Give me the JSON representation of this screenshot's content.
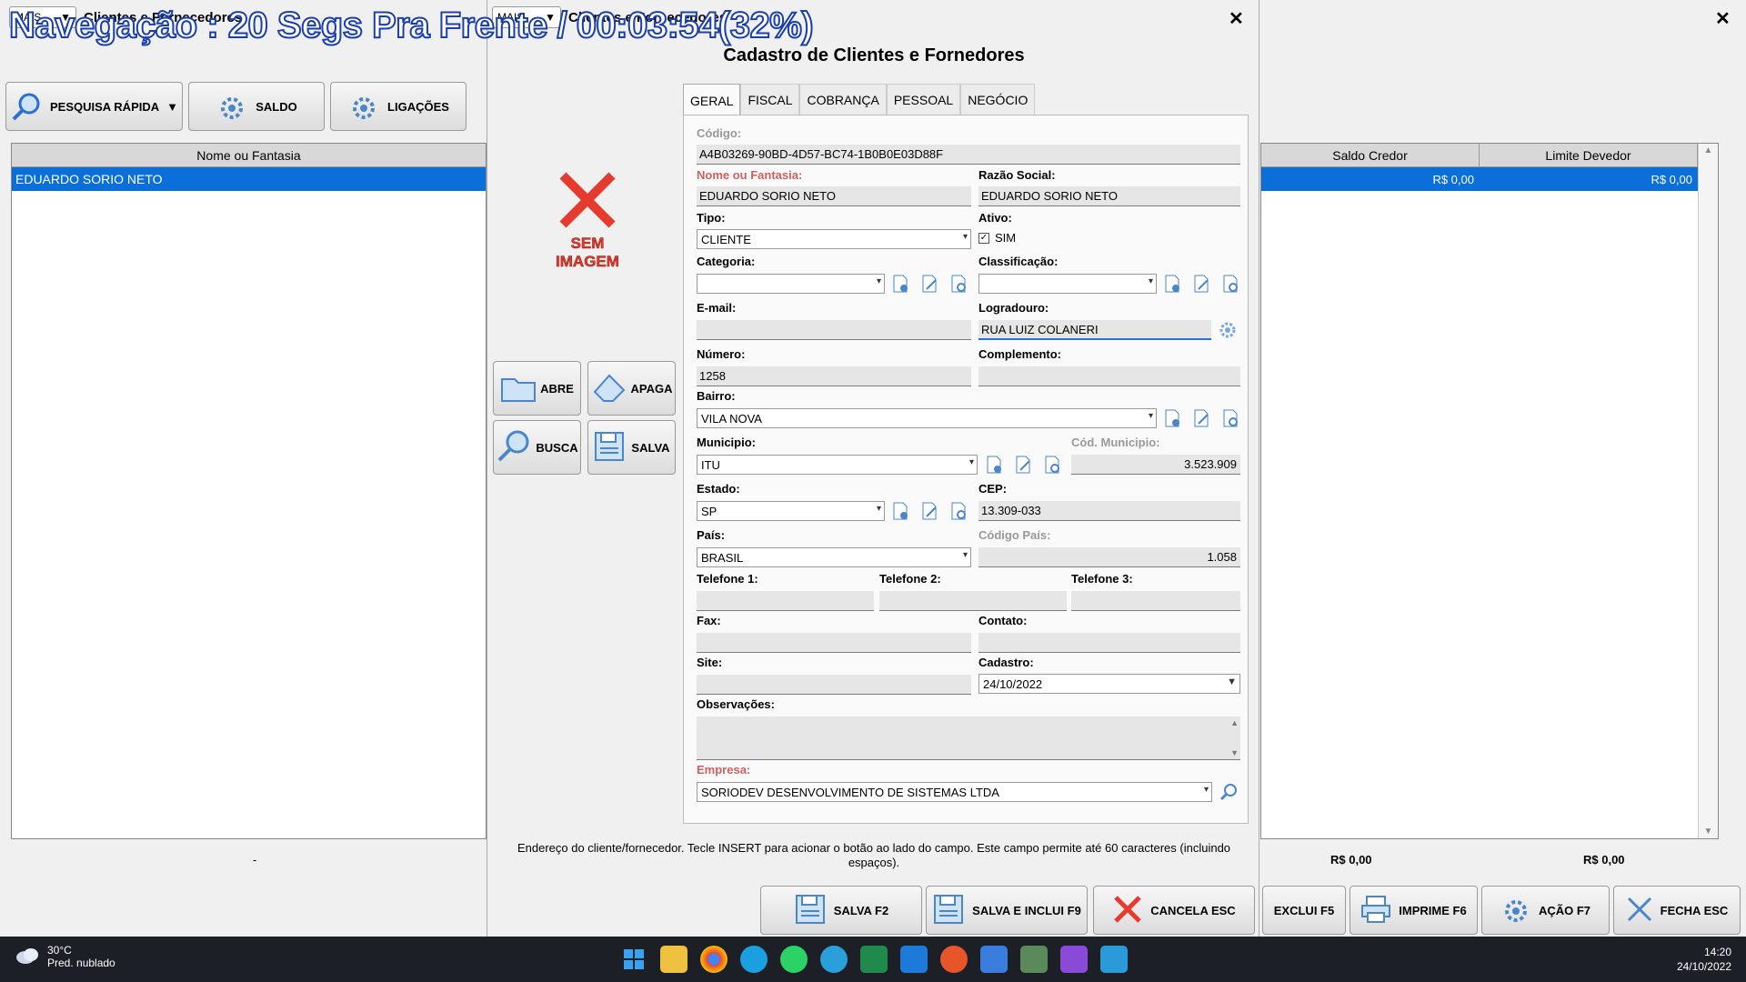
{
  "overlay": {
    "text": "Navegação : 20 Segs Pra Frente / 00:03:54(32%)"
  },
  "bgwindow": {
    "mais_label": "MAIS...",
    "title": "Clientes e Fornecedores",
    "buttons": {
      "pesquisa": "PESQUISA RÁPIDA",
      "saldo": "SALDO",
      "ligacoes": "LIGAÇÕES"
    },
    "list": {
      "header": "Nome ou Fantasia",
      "rows": [
        "EDUARDO SORIO NETO"
      ],
      "footer": "-"
    },
    "grid": {
      "headers": [
        "Saldo Credor",
        "Limite Devedor"
      ],
      "row": [
        "R$ 0,00",
        "R$ 0,00"
      ],
      "footer": [
        "R$ 0,00",
        "R$ 0,00"
      ]
    },
    "bottom_buttons": {
      "exclui": "EXCLUI F5",
      "imprime": "IMPRIME F6",
      "acao": "AÇÃO F7",
      "fecha": "FECHA ESC"
    }
  },
  "dialog": {
    "mais_label": "MAIS",
    "window_title": "Clientes e Fornecedores",
    "title": "Cadastro de Clientes e Fornedores",
    "photo_text": [
      "SEM",
      "IMAGEM"
    ],
    "side_buttons": {
      "abre": "ABRE",
      "apaga": "APAGA",
      "busca": "BUSCA",
      "salva": "SALVA"
    },
    "tabs": [
      "GERAL",
      "FISCAL",
      "COBRANÇA",
      "PESSOAL",
      "NEGÓCIO"
    ],
    "form": {
      "codigo_label": "Código:",
      "codigo": "A4B03269-90BD-4D57-BC74-1B0B0E03D88F",
      "nome_label": "Nome ou Fantasia:",
      "nome": "EDUARDO SORIO NETO",
      "razao_label": "Razão Social:",
      "razao": "EDUARDO SORIO NETO",
      "tipo_label": "Tipo:",
      "tipo": "CLIENTE",
      "ativo_label": "Ativo:",
      "ativo_checkbox": "SIM",
      "categoria_label": "Categoria:",
      "categoria": "",
      "classificacao_label": "Classificação:",
      "classificacao": "",
      "email_label": "E-mail:",
      "email": "",
      "logradouro_label": "Logradouro:",
      "logradouro": "RUA LUIZ COLANERI",
      "numero_label": "Número:",
      "numero": "1258",
      "complemento_label": "Complemento:",
      "complemento": "",
      "bairro_label": "Bairro:",
      "bairro": "VILA NOVA",
      "municipio_label": "Municipio:",
      "municipio": "ITU",
      "cod_municipio_label": "Cód. Municipio:",
      "cod_municipio": "3.523.909",
      "estado_label": "Estado:",
      "estado": "SP",
      "cep_label": "CEP:",
      "cep": "13.309-033",
      "pais_label": "País:",
      "pais": "BRASIL",
      "cod_pais_label": "Código País:",
      "cod_pais": "1.058",
      "tel1_label": "Telefone 1:",
      "tel2_label": "Telefone 2:",
      "tel3_label": "Telefone 3:",
      "fax_label": "Fax:",
      "contato_label": "Contato:",
      "site_label": "Site:",
      "cadastro_label": "Cadastro:",
      "cadastro": "24/10/2022",
      "obs_label": "Observações:",
      "empresa_label": "Empresa:",
      "empresa": "SORIODEV DESENVOLVIMENTO DE SISTEMAS LTDA"
    },
    "hint": "Endereço do cliente/fornecedor. Tecle INSERT para acionar o botão ao lado do campo. Este campo permite até 60 caracteres (incluindo espaços).",
    "buttons": {
      "salva": "SALVA F2",
      "salva_inclui": "SALVA E INCLUI F9",
      "cancela": "CANCELA ESC"
    }
  },
  "taskbar": {
    "weather_temp": "30°C",
    "weather_desc": "Pred. nublado",
    "time": "14:20",
    "date": "24/10/2022"
  },
  "colors": {
    "selection": "#0a6fd8",
    "overlay_stroke": "#1b3fa8",
    "required_label": "#d06060",
    "taskbar": "#1d1f27"
  }
}
